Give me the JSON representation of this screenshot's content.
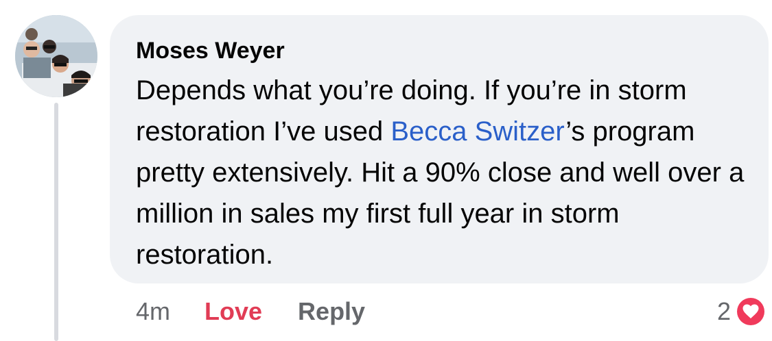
{
  "comment": {
    "author": "Moses Weyer",
    "text_before_mention": "Depends what you’re doing. If you’re in storm restoration I’ve used ",
    "mention": "Becca Switzer",
    "text_after_mention": "’s program pretty extensively. Hit a 90% close and well over a million in sales my first full year in storm restoration."
  },
  "actions": {
    "time": "4m",
    "love_label": "Love",
    "reply_label": "Reply"
  },
  "reactions": {
    "count": "2",
    "icon": "heart-icon",
    "color": "#f03a5b"
  },
  "colors": {
    "bubble": "#f0f2f5",
    "mention": "#2a5fc9",
    "love": "#e13c55"
  }
}
